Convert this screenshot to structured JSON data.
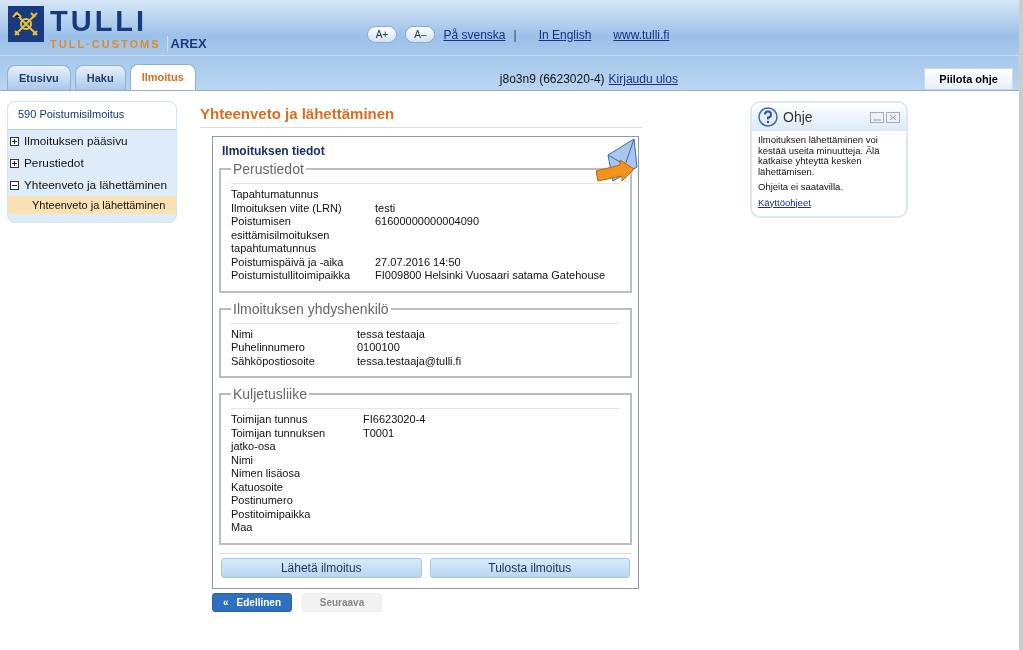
{
  "header": {
    "logo_title": "TULLI",
    "logo_subtitle": "TULL·CUSTOMS",
    "app_name": "AREX",
    "font_buttons": [
      "A+",
      "A–"
    ],
    "links": [
      {
        "label": "På svenska",
        "separator": "|"
      },
      {
        "label": "In English"
      },
      {
        "label": "www.tulli.fi"
      }
    ]
  },
  "tabs": [
    {
      "label": "Etusivu",
      "selected": false
    },
    {
      "label": "Haku",
      "selected": false
    },
    {
      "label": "Ilmoitus",
      "selected": true
    }
  ],
  "user": {
    "name": "j8o3n9 (6623020-4)",
    "logout": "Kirjaudu ulos"
  },
  "hide_help_button": "Piilota ohje",
  "sidebar": {
    "title": "590 Poistumisilmoitus",
    "items": [
      {
        "label": "Ilmoituksen pääsivu",
        "expanded": false,
        "selected": false
      },
      {
        "label": "Perustiedot",
        "expanded": false,
        "selected": false
      },
      {
        "label": "Yhteenveto ja lähettäminen",
        "expanded": true,
        "selected": false,
        "children": [
          {
            "label": "Yhteenveto ja lähettäminen",
            "selected": true
          }
        ]
      }
    ]
  },
  "main": {
    "title": "Yhteenveto ja lähettäminen",
    "panel_title": "Ilmoituksen tiedot",
    "sections": [
      {
        "title": "Perustiedot",
        "fields": [
          {
            "label": "Tapahtumatunnus"
          },
          {
            "label": "Ilmoituksen viite (LRN)",
            "value": "testi"
          },
          {
            "label": "Poistumisen esittämisilmoituksen tapahtumatunnus",
            "value": "61600000000004090"
          },
          {
            "label": "Poistumispäivä ja -aika",
            "value": "27.07.2016 14:50"
          },
          {
            "label": "Poistumistullitoimipaikka",
            "value": "FI009800  Helsinki Vuosaari satama Gatehouse"
          }
        ]
      },
      {
        "title": "Ilmoituksen yhdyshenkilö",
        "fields": [
          {
            "label": "Nimi",
            "value": "tessa testaaja"
          },
          {
            "label": "Puhelinnumero",
            "value": "0100100"
          },
          {
            "label": "Sähköpostiosoite",
            "value": "tessa.testaaja@tulli.fi"
          }
        ]
      },
      {
        "title": "Kuljetusliike",
        "fields": [
          {
            "label": "Toimijan tunnus",
            "value": "FI6623020-4"
          },
          {
            "label": "Toimijan tunnuksen jatko-osa",
            "value": "T0001"
          },
          {
            "label": "Nimi"
          },
          {
            "label": "Nimen lisäosa"
          },
          {
            "label": "Katuosoite"
          },
          {
            "label": "Postinumero"
          },
          {
            "label": "Postitoimipaikka"
          },
          {
            "label": "Maa"
          }
        ]
      }
    ],
    "actions": [
      "Lähetä ilmoitus",
      "Tulosta ilmoitus"
    ],
    "nav": [
      {
        "icon": "«",
        "label": "Edellinen",
        "disabled": false
      },
      {
        "label": "Seuraava",
        "disabled": true
      }
    ]
  },
  "help": {
    "title": "Ohje",
    "paragraphs": [
      "Ilmoituksen lähettäminen voi kestää useita minuutteja. Älä katkaise yhteyttä kesken lähettämisen.",
      "Ohjeita ei saatavilla."
    ],
    "link": "Käyttöohjeet"
  }
}
